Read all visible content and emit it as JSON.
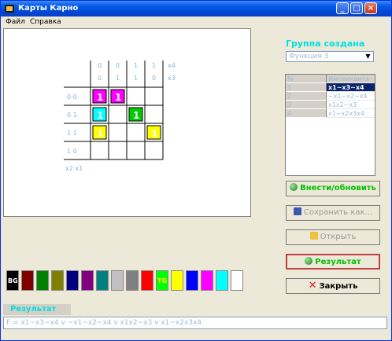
{
  "window": {
    "title": "Карты Карно"
  },
  "menu": [
    "Файл",
    "Справка"
  ],
  "kmap": {
    "col_header_row1": [
      "0",
      "0",
      "1",
      "1"
    ],
    "col_header_row2": [
      "0",
      "1",
      "1",
      "0"
    ],
    "col_var1": "x4",
    "col_var2": "x3",
    "row_headers": [
      "0  0",
      "0  1",
      "1  1",
      "1  0"
    ],
    "row_vars": "x2  x1",
    "cells": [
      {
        "row": 0,
        "col": 0,
        "value": "1",
        "color": "#ff00ff"
      },
      {
        "row": 0,
        "col": 1,
        "value": "1",
        "color": "#ff00ff"
      },
      {
        "row": 1,
        "col": 0,
        "value": "1",
        "color": "#00ffff"
      },
      {
        "row": 1,
        "col": 2,
        "value": "1",
        "color": "#00cc00"
      },
      {
        "row": 2,
        "col": 0,
        "value": "1",
        "color": "#ffff00"
      },
      {
        "row": 2,
        "col": 3,
        "value": "1",
        "color": "#ffff00"
      }
    ]
  },
  "group": {
    "label": "Группа создана",
    "selected_function": "Функция 3"
  },
  "grid": {
    "header": [
      "№",
      "Импликанта"
    ],
    "rows": [
      {
        "n": "1",
        "term": "x1~x3~x4",
        "selected": true
      },
      {
        "n": "2",
        "term": "~x1~x2~x4",
        "selected": false
      },
      {
        "n": "3",
        "term": "x1x2~x3",
        "selected": false
      },
      {
        "n": "4",
        "term": "x1~x2x3x4",
        "selected": false
      }
    ]
  },
  "buttons": {
    "add_update": "Внести/обновить",
    "save": "Сохранить как...",
    "open": "Открыть",
    "result": "Результат",
    "close": "Закрыть"
  },
  "colors": {
    "accent_green": "#00c000",
    "accent_cyan": "#00e0e0",
    "selection": "#0a246a"
  },
  "palette": [
    {
      "color": "#000000",
      "label": "BG"
    },
    {
      "color": "#800000",
      "label": ""
    },
    {
      "color": "#008000",
      "label": ""
    },
    {
      "color": "#808000",
      "label": ""
    },
    {
      "color": "#000080",
      "label": ""
    },
    {
      "color": "#800080",
      "label": ""
    },
    {
      "color": "#008080",
      "label": ""
    },
    {
      "color": "#c0c0c0",
      "label": ""
    },
    {
      "color": "#808080",
      "label": ""
    },
    {
      "color": "#ff0000",
      "label": ""
    },
    {
      "color": "#00ff00",
      "label": "TG"
    },
    {
      "color": "#ffff00",
      "label": ""
    },
    {
      "color": "#0000ff",
      "label": ""
    },
    {
      "color": "#ff00ff",
      "label": ""
    },
    {
      "color": "#00ffff",
      "label": ""
    },
    {
      "color": "#ffffff",
      "label": ""
    }
  ],
  "result": {
    "label": "Результат",
    "text": "F = x1~x3~x4 v ~x1~x2~x4 v x1x2~x3 v x1~x2x3x4"
  }
}
